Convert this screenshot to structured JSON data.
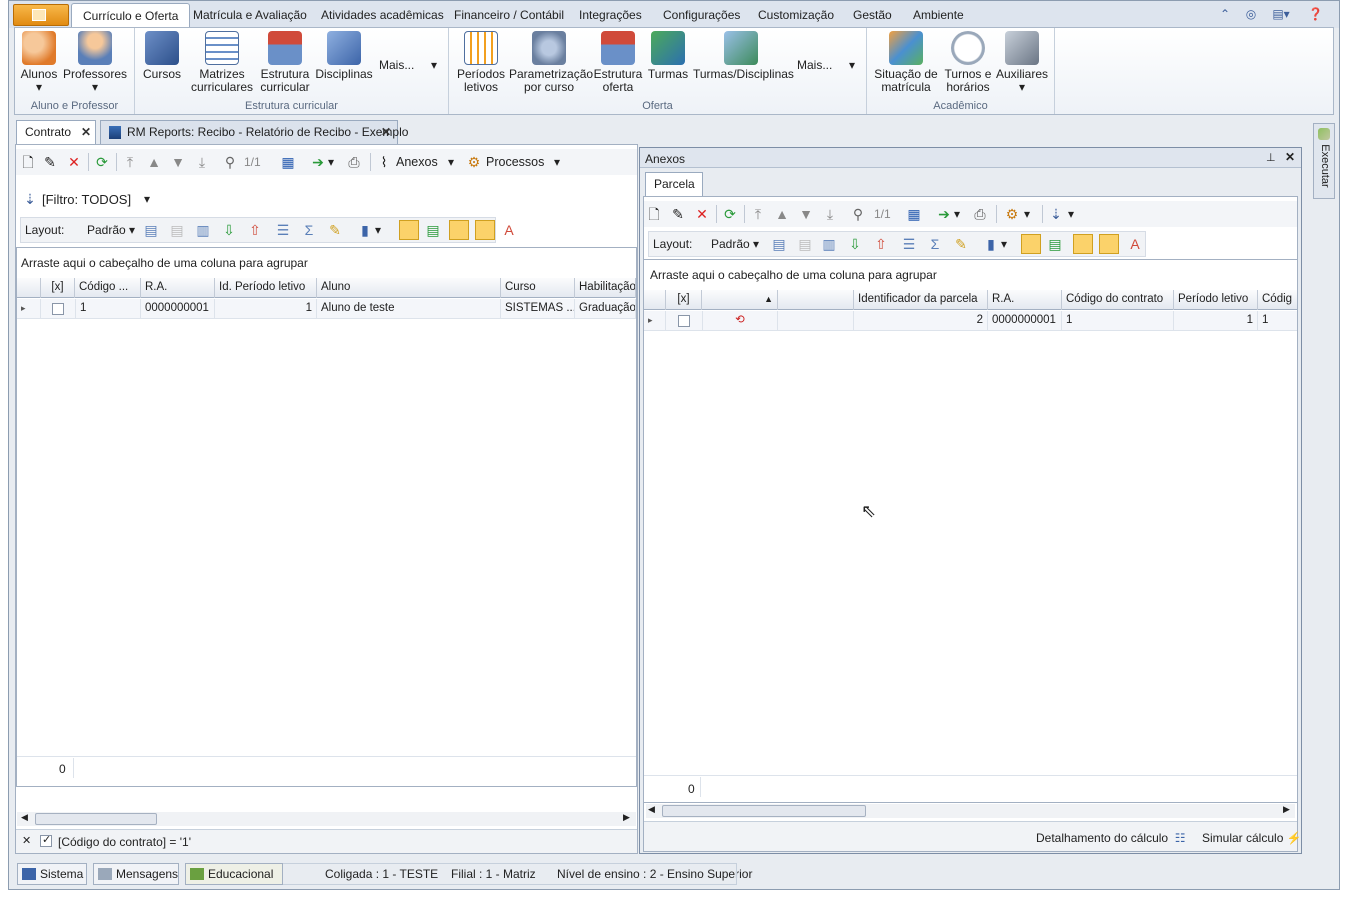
{
  "menubar": {
    "tabs": [
      "Currículo e Oferta",
      "Matrícula e Avaliação",
      "Atividades acadêmicas",
      "Financeiro / Contábil",
      "Integrações",
      "Configurações",
      "Customização",
      "Gestão",
      "Ambiente"
    ],
    "right_icons": [
      "chevron-up-icon",
      "help-web-icon",
      "layout-icon",
      "help-icon"
    ]
  },
  "ribbon": {
    "groups": [
      {
        "label": "Aluno e Professor",
        "buttons": [
          "Alunos",
          "Professores"
        ]
      },
      {
        "label": "Estrutura curricular",
        "buttons": [
          "Cursos",
          "Matrizes curriculares",
          "Estrutura curricular",
          "Disciplinas"
        ],
        "more": "Mais..."
      },
      {
        "label": "Oferta",
        "buttons": [
          "Períodos letivos",
          "Parametrização por curso",
          "Estrutura oferta",
          "Turmas",
          "Turmas/Disciplinas"
        ],
        "more": "Mais..."
      },
      {
        "label": "Acadêmico",
        "buttons": [
          "Situação de matrícula",
          "Turnos e horários",
          "Auxiliares"
        ]
      }
    ],
    "btn_lines": {
      "alunos": "Alunos",
      "professores": "Professores",
      "cursos": "Cursos",
      "matrizes1": "Matrizes",
      "matrizes2": "curriculares",
      "estrutura1": "Estrutura",
      "estrutura2": "curricular",
      "disciplinas": "Disciplinas",
      "mais": "Mais...",
      "periodos1": "Períodos",
      "periodos2": "letivos",
      "param1": "Parametrização",
      "param2": "por curso",
      "oferta1": "Estrutura",
      "oferta2": "oferta",
      "turmas": "Turmas",
      "turmasdisc": "Turmas/Disciplinas",
      "situacao1": "Situação de",
      "situacao2": "matrícula",
      "turnos1": "Turnos e",
      "turnos2": "horários",
      "auxiliares": "Auxiliares"
    }
  },
  "doc_tabs": {
    "contrato": "Contrato",
    "report": "RM Reports: Recibo - Relatório de Recibo - Exemplo"
  },
  "left": {
    "toolbar": {
      "paging": "1/1",
      "anexos": "Anexos",
      "processos": "Processos"
    },
    "filter": "[Filtro: TODOS]",
    "layout_label": "Layout:",
    "layout_value": "Padrão",
    "group_hint": "Arraste aqui o cabeçalho de uma coluna para agrupar",
    "columns": [
      "[x]",
      "Código ...",
      "R.A.",
      "Id. Período letivo",
      "Aluno",
      "Curso",
      "Habilitação"
    ],
    "row": {
      "codigo": "1",
      "ra": "0000000001",
      "periodo": "1",
      "aluno": "Aluno de teste",
      "curso": "SISTEMAS ...",
      "habilitacao": "Graduação"
    },
    "footer_count": "0",
    "filter_expr": "[Código do contrato] = '1'"
  },
  "right": {
    "title": "Anexos",
    "tab": "Parcela",
    "toolbar": {
      "paging": "1/1"
    },
    "layout_label": "Layout:",
    "layout_value": "Padrão",
    "group_hint": "Arraste aqui o cabeçalho de uma coluna para agrupar",
    "columns": [
      "[x]",
      "",
      "",
      "Identificador da parcela",
      "R.A.",
      "Código do contrato",
      "Período letivo",
      "Códig"
    ],
    "row": {
      "id": "2",
      "ra": "0000000001",
      "contrato": "1",
      "periodo": "1",
      "codigo": "1"
    },
    "footer_count": "0",
    "detalhamento": "Detalhamento do cálculo",
    "simular": "Simular cálculo"
  },
  "side_button": "Executar",
  "statusbar": {
    "sistema": "Sistema",
    "mensagens": "Mensagens",
    "educacional": "Educacional",
    "coligada": "Coligada : 1 - TESTE",
    "filial": "Filial : 1 - Matriz",
    "nivel": "Nível de ensino : 2 - Ensino Superior"
  },
  "colors": {
    "accent": "#e18b12",
    "grid_border": "#a3b0c2",
    "frame": "#e8ecf1"
  }
}
